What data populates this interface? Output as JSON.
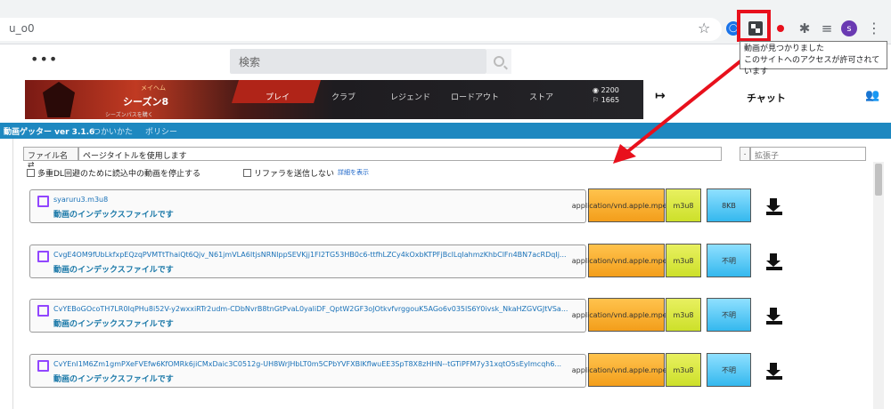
{
  "browser": {
    "url_fragment": "u_o0",
    "avatar_letter": "s",
    "tooltip_line1": "動画が見つかりました",
    "tooltip_line2": "このサイトへのアクセスが許可されています"
  },
  "site": {
    "search_placeholder": "検索",
    "banner": {
      "season_top": "メイヘム",
      "season": "シーズン8",
      "sub": "シーズンパスを購く",
      "nav": [
        "プレイ",
        "クラブ",
        "レジェンド",
        "ロードアウト",
        "ストア"
      ],
      "stat1": "2200",
      "stat2": "1665"
    },
    "chat_title": "チャット"
  },
  "getter": {
    "title": "動画ゲッター ver 3.1.6",
    "links": [
      "つかいかた",
      "ポリシー"
    ],
    "filename_label": "ファイル名 ⇄",
    "filename_value": "ページタイトルを使用します",
    "ext_dot": ".",
    "ext_placeholder": "拡張子",
    "checkbox1": "多重DL回避のために読込中の動画を停止する",
    "checkbox2": "リファラを送信しない",
    "detail_link": "詳細を表示",
    "rows": [
      {
        "name": "syaruru3.m3u8",
        "desc": "動画のインデックスファイルです",
        "mime": "application/vnd.apple.mpegurl",
        "type": "m3u8",
        "size": "8KB"
      },
      {
        "name": "CvgE4OM9fUbLkfxpEQzqPVMTtThaiQt6Qjv_N61jmVLA6ItjsNRNlppSEVKjj1FI2TG53HB0c6-ttfhLZCy4kOxbKTPFjBclLqIahmzKhbClFn4BN7acRDqIj...",
        "desc": "動画のインデックスファイルです",
        "mime": "application/vnd.apple.mpegurl",
        "type": "m3u8",
        "size": "不明"
      },
      {
        "name": "CvYEBoGOcoTH7LR0IqPHu8i52V-y2wxxiRTr2udm-CDbNvrB8tnGtPvaL0yaliDF_QptW2GF3oJOtkvfvrggouK5AGo6v035lS6Y0ivsk_NkaHZGVGJtVSa...",
        "desc": "動画のインデックスファイルです",
        "mime": "application/vnd.apple.mpegurl",
        "type": "m3u8",
        "size": "不明"
      },
      {
        "name": "CvYEnI1M6Zm1gmPXeFVEfw6KfOMRk6jiCMxDaic3C0512g-UH8WrJHbLT0m5CPbYVFXBlKflwuEE3SpT8X8zHHN--tGTiPFM7y31xqtO5sEyImcqh6...",
        "desc": "動画のインデックスファイルです",
        "mime": "application/vnd.apple.mpegurl",
        "type": "m3u8",
        "size": "不明"
      }
    ]
  },
  "colors": {
    "highlight": "#e8101c",
    "getter_bar": "#1e88c0",
    "mime_cell": "#f39e1b",
    "type_cell": "#cde02a",
    "size_cell": "#34b8ee"
  }
}
